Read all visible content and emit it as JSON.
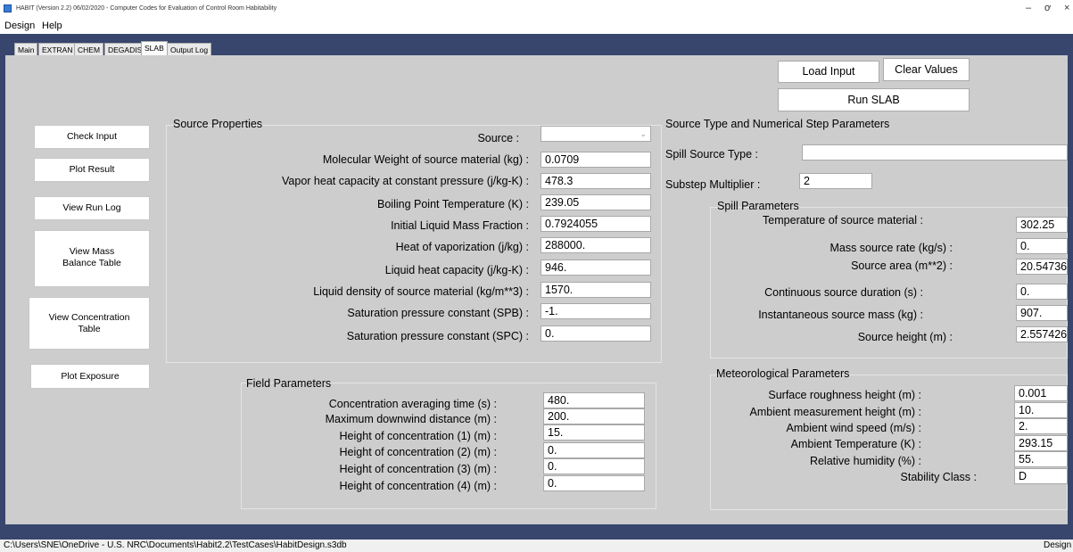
{
  "window": {
    "title": "HABIT (Version 2.2) 06/02/2020 - Computer Codes for Evaluation of Control Room Habitability",
    "icon": "app-icon",
    "controls": {
      "minimize": "–",
      "maximize": "ơ",
      "close": "×"
    }
  },
  "menu": [
    {
      "label": "Design"
    },
    {
      "label": "Help"
    }
  ],
  "tabs": [
    {
      "label": "Main"
    },
    {
      "label": "EXTRAN"
    },
    {
      "label": "CHEM"
    },
    {
      "label": "DEGADIS"
    },
    {
      "label": "SLAB",
      "active": true
    },
    {
      "label": "Output Log"
    }
  ],
  "top_buttons": {
    "load_input": "Load Input",
    "clear_values": "Clear Values",
    "run_slab": "Run SLAB"
  },
  "side_buttons": {
    "check_input": "Check Input",
    "plot_result": "Plot Result",
    "view_run_log": "View Run Log",
    "view_mass_balance": "View Mass Balance Table",
    "view_concentration": "View Concentration Table",
    "plot_exposure": "Plot Exposure"
  },
  "source_properties": {
    "title": "Source Properties",
    "source_label": "Source :",
    "source_value": "",
    "rows": [
      {
        "label": "Molecular Weight of source material (kg) :",
        "value": "0.0709"
      },
      {
        "label": "Vapor heat capacity at constant pressure (j/kg-K) :",
        "value": "478.3"
      },
      {
        "label": "Boiling Point Temperature (K) :",
        "value": "239.05"
      },
      {
        "label": "Initial Liquid Mass Fraction :",
        "value": "0.7924055"
      },
      {
        "label": "Heat of vaporization (j/kg) :",
        "value": "288000."
      },
      {
        "label": "Liquid heat capacity (j/kg-K) :",
        "value": "946."
      },
      {
        "label": "Liquid density of source material (kg/m**3) :",
        "value": "1570."
      },
      {
        "label": "Saturation pressure constant (SPB) :",
        "value": "-1."
      },
      {
        "label": "Saturation pressure constant (SPC) :",
        "value": "0."
      }
    ]
  },
  "source_type": {
    "title": "Source Type and Numerical Step Parameters",
    "spill_source_type_label": "Spill Source Type :",
    "spill_source_type_value": "",
    "substep_label": "Substep Multiplier :",
    "substep_value": "2"
  },
  "spill_parameters": {
    "title": "Spill Parameters",
    "rows": [
      {
        "label": "Temperature of source material :",
        "value": "302.25"
      },
      {
        "label": "Mass source rate (kg/s) :",
        "value": "0."
      },
      {
        "label": "Source area (m**2) :",
        "value": "20.54736"
      },
      {
        "label": "Continuous source duration (s) :",
        "value": "0."
      },
      {
        "label": "Instantaneous source mass (kg) :",
        "value": "907."
      },
      {
        "label": "Source height (m) :",
        "value": "2.557426"
      }
    ]
  },
  "field_parameters": {
    "title": "Field Parameters",
    "rows": [
      {
        "label": "Concentration averaging time (s) :",
        "value": "480."
      },
      {
        "label": "Maximum downwind distance (m) :",
        "value": "200."
      },
      {
        "label": "Height of concentration (1) (m) :",
        "value": "15."
      },
      {
        "label": "Height of concentration (2) (m) :",
        "value": "0."
      },
      {
        "label": "Height of concentration (3) (m) :",
        "value": "0."
      },
      {
        "label": "Height of concentration (4) (m) :",
        "value": "0."
      }
    ]
  },
  "met_parameters": {
    "title": "Meteorological Parameters",
    "rows": [
      {
        "label": "Surface roughness height (m) :",
        "value": "0.001"
      },
      {
        "label": "Ambient measurement height (m) :",
        "value": "10."
      },
      {
        "label": "Ambient wind speed (m/s) :",
        "value": "2."
      },
      {
        "label": "Ambient Temperature (K) :",
        "value": "293.15"
      },
      {
        "label": "Relative humidity (%) :",
        "value": "55."
      },
      {
        "label": "Stability Class :",
        "value": "D"
      }
    ]
  },
  "statusbar": {
    "path": "C:\\Users\\SNE\\OneDrive - U.S. NRC\\Documents\\Habit2.2\\TestCases\\HabitDesign.s3db",
    "mode": "Design"
  },
  "colors": {
    "frame": "#38466e",
    "panel": "#cdcdcd"
  }
}
